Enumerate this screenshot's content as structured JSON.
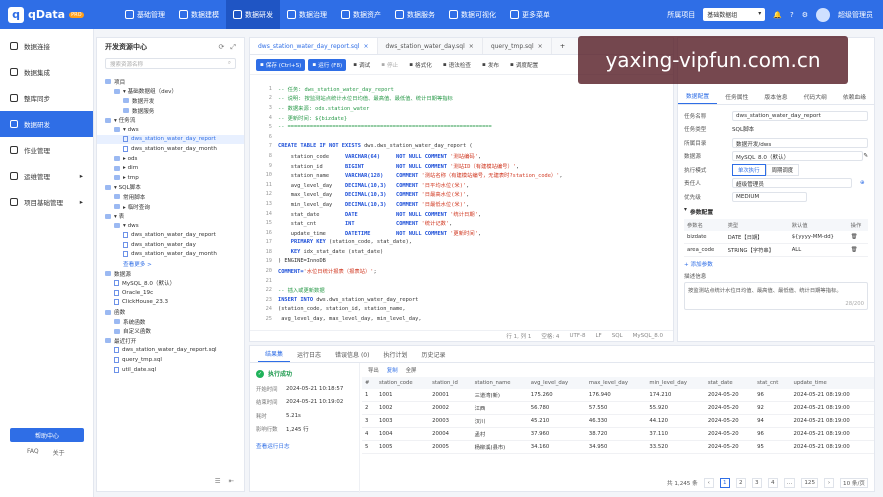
{
  "app": {
    "name": "qData",
    "badge": "PRO"
  },
  "topnav": [
    {
      "label": "基础管理",
      "icon": "grid-icon"
    },
    {
      "label": "数据建模",
      "icon": "cube-icon"
    },
    {
      "label": "数据研发",
      "icon": "code-icon",
      "active": true
    },
    {
      "label": "数据治理",
      "icon": "shield-icon"
    },
    {
      "label": "数据资产",
      "icon": "database-icon"
    },
    {
      "label": "数据服务",
      "icon": "api-icon"
    },
    {
      "label": "数据可视化",
      "icon": "chart-icon"
    },
    {
      "label": "更多菜单",
      "icon": "menu-icon"
    }
  ],
  "topright": {
    "project_label": "所属项目",
    "project_value": "基础数据组",
    "user": "超级管理员"
  },
  "sidebar": {
    "items": [
      {
        "label": "数据连接"
      },
      {
        "label": "数据集成"
      },
      {
        "label": "整库同步"
      },
      {
        "label": "数据研发",
        "active": true
      },
      {
        "label": "作业管理"
      },
      {
        "label": "运维管理",
        "arrow": "▸"
      },
      {
        "label": "项目基础管理",
        "arrow": "▸"
      }
    ],
    "help": "帮助中心",
    "faq": "FAQ",
    "about": "关于"
  },
  "tree_panel": {
    "title": "开发资源中心",
    "search_placeholder": "搜索资源名称",
    "rows": [
      {
        "indent": 0,
        "kind": "folder",
        "text": "项目"
      },
      {
        "indent": 1,
        "kind": "folder",
        "text": "▾ 基础数据组（dev）"
      },
      {
        "indent": 2,
        "kind": "folder",
        "text": "数据开发"
      },
      {
        "indent": 2,
        "kind": "folder",
        "text": "数据服务"
      },
      {
        "indent": 0,
        "kind": "folder",
        "text": "▾ 任务流"
      },
      {
        "indent": 1,
        "kind": "folder",
        "text": "▾ dws"
      },
      {
        "indent": 2,
        "kind": "file",
        "text": "dws_station_water_day_report",
        "selected": true
      },
      {
        "indent": 2,
        "kind": "file",
        "text": "dws_station_water_day_month"
      },
      {
        "indent": 1,
        "kind": "folder",
        "text": "▸ ods"
      },
      {
        "indent": 1,
        "kind": "folder",
        "text": "▸ dim"
      },
      {
        "indent": 1,
        "kind": "folder",
        "text": "▸ tmp"
      },
      {
        "indent": 0,
        "kind": "folder",
        "text": "▾ SQL脚本"
      },
      {
        "indent": 1,
        "kind": "folder",
        "text": "常用脚本"
      },
      {
        "indent": 1,
        "kind": "folder",
        "text": "▸ 临时查询"
      },
      {
        "indent": 0,
        "kind": "folder",
        "text": "▾ 表"
      },
      {
        "indent": 1,
        "kind": "folder",
        "text": "▾ dws"
      },
      {
        "indent": 2,
        "kind": "file",
        "text": "dws_station_water_day_report"
      },
      {
        "indent": 2,
        "kind": "file",
        "text": "dws_station_water_day"
      },
      {
        "indent": 2,
        "kind": "file",
        "text": "dws_station_water_day_month"
      },
      {
        "indent": 2,
        "kind": "more",
        "text": "查看更多 >"
      },
      {
        "indent": 0,
        "kind": "folder",
        "text": "数据源"
      },
      {
        "indent": 1,
        "kind": "file",
        "text": "MySQL_8.0（默认）"
      },
      {
        "indent": 1,
        "kind": "file",
        "text": "Oracle_19c"
      },
      {
        "indent": 1,
        "kind": "file",
        "text": "ClickHouse_23.3"
      },
      {
        "indent": 0,
        "kind": "folder",
        "text": "函数"
      },
      {
        "indent": 1,
        "kind": "folder",
        "text": "系统函数"
      },
      {
        "indent": 1,
        "kind": "folder",
        "text": "自定义函数"
      },
      {
        "indent": 0,
        "kind": "folder",
        "text": "最近打开"
      },
      {
        "indent": 1,
        "kind": "file",
        "text": "dws_station_water_day_report.sql"
      },
      {
        "indent": 1,
        "kind": "file",
        "text": "query_tmp.sql"
      },
      {
        "indent": 1,
        "kind": "file",
        "text": "util_date.sql"
      }
    ]
  },
  "editor": {
    "tabs": [
      {
        "label": "dws_station_water_day_report.sql",
        "active": true
      },
      {
        "label": "dws_station_water_day.sql"
      },
      {
        "label": "query_tmp.sql"
      }
    ],
    "toolbar": [
      {
        "label": "保存 (Ctrl+S)",
        "style": "primary",
        "icon": "save-icon"
      },
      {
        "label": "运行 (F8)",
        "style": "primary",
        "icon": "play-icon"
      },
      {
        "label": "调试",
        "style": "",
        "icon": "bug-icon"
      },
      {
        "label": "停止",
        "style": "dis",
        "icon": "stop-icon"
      },
      {
        "label": "格式化",
        "style": "",
        "icon": "format-icon"
      },
      {
        "label": "语法检查",
        "style": "",
        "icon": "check-icon"
      },
      {
        "label": "发布",
        "style": "",
        "icon": "publish-icon"
      },
      {
        "label": "调度配置",
        "style": "",
        "icon": "schedule-icon"
      }
    ],
    "lines": [
      {
        "no": "1",
        "parts": [
          [
            "cmt",
            "-- 任务: dws_station_water_day_report"
          ]
        ]
      },
      {
        "no": "2",
        "parts": [
          [
            "cmt",
            "-- 说明: 按监测站点统计水位日均值、最高值、最低值、统计日期等指标"
          ]
        ]
      },
      {
        "no": "3",
        "parts": [
          [
            "cmt",
            "-- 数据来源: ods.station_water"
          ]
        ]
      },
      {
        "no": "4",
        "parts": [
          [
            "cmt",
            "-- 更新时间: ${bizdate}"
          ]
        ]
      },
      {
        "no": "5",
        "parts": [
          [
            "cmt",
            "-- ================================================================"
          ]
        ]
      },
      {
        "no": "6",
        "parts": [
          [
            "",
            ""
          ]
        ]
      },
      {
        "no": "7",
        "parts": [
          [
            "kw",
            "CREATE TABLE IF NOT EXISTS "
          ],
          [
            "",
            "dws.dws_station_water_day_report ("
          ]
        ]
      },
      {
        "no": "8",
        "parts": [
          [
            "",
            "    station_code     "
          ],
          [
            "kw",
            "VARCHAR(64)     NOT NULL COMMENT "
          ],
          [
            "str",
            "'测站编码'"
          ],
          [
            "",
            ","
          ]
        ]
      },
      {
        "no": "9",
        "parts": [
          [
            "",
            "    station_id       "
          ],
          [
            "kw",
            "BIGINT          NOT NULL COMMENT "
          ],
          [
            "str",
            "'测站ID（有建模站编号）'"
          ],
          [
            "",
            ","
          ]
        ]
      },
      {
        "no": "10",
        "parts": [
          [
            "",
            "    station_name     "
          ],
          [
            "kw",
            "VARCHAR(128)    COMMENT "
          ],
          [
            "str",
            "'测站名称（有建模站编号，无建表时?station_code）'"
          ],
          [
            "",
            ","
          ]
        ]
      },
      {
        "no": "11",
        "parts": [
          [
            "",
            "    avg_level_day    "
          ],
          [
            "kw",
            "DECIMAL(10,3)   COMMENT "
          ],
          [
            "str",
            "'日平均水位(米)'"
          ],
          [
            "",
            ","
          ]
        ]
      },
      {
        "no": "12",
        "parts": [
          [
            "",
            "    max_level_day    "
          ],
          [
            "kw",
            "DECIMAL(10,3)   COMMENT "
          ],
          [
            "str",
            "'日最高水位(米)'"
          ],
          [
            "",
            ","
          ]
        ]
      },
      {
        "no": "13",
        "parts": [
          [
            "",
            "    min_level_day    "
          ],
          [
            "kw",
            "DECIMAL(10,3)   COMMENT "
          ],
          [
            "str",
            "'日最低水位(米)'"
          ],
          [
            "",
            ","
          ]
        ]
      },
      {
        "no": "14",
        "parts": [
          [
            "",
            "    stat_date        "
          ],
          [
            "kw",
            "DATE            NOT NULL COMMENT "
          ],
          [
            "str",
            "'统计日期'"
          ],
          [
            "",
            ","
          ]
        ]
      },
      {
        "no": "15",
        "parts": [
          [
            "",
            "    stat_cnt         "
          ],
          [
            "kw",
            "INT             COMMENT "
          ],
          [
            "str",
            "'统计记数'"
          ],
          [
            "",
            ","
          ]
        ]
      },
      {
        "no": "16",
        "parts": [
          [
            "",
            "    update_time      "
          ],
          [
            "kw",
            "DATETIME        NOT NULL COMMENT "
          ],
          [
            "str",
            "'更新时间'"
          ],
          [
            "",
            ","
          ]
        ]
      },
      {
        "no": "17",
        "parts": [
          [
            "kw",
            "    PRIMARY KEY "
          ],
          [
            "",
            "(station_code, stat_date),"
          ]
        ]
      },
      {
        "no": "18",
        "parts": [
          [
            "kw",
            "    KEY "
          ],
          [
            "",
            "idx_stat_date (stat_date)"
          ]
        ]
      },
      {
        "no": "19",
        "parts": [
          [
            "",
            ") ENGINE=InnoDB"
          ]
        ]
      },
      {
        "no": "20",
        "parts": [
          [
            "kw",
            "COMMENT="
          ],
          [
            "str",
            "'水位日统计报表（报表站）'"
          ],
          [
            "",
            ";"
          ]
        ]
      },
      {
        "no": "21",
        "parts": [
          [
            "",
            ""
          ]
        ]
      },
      {
        "no": "22",
        "parts": [
          [
            "cmt",
            "-- 插入或更新数据"
          ]
        ]
      },
      {
        "no": "23",
        "parts": [
          [
            "kw",
            "INSERT INTO "
          ],
          [
            "",
            "dws.dws_station_water_day_report"
          ]
        ]
      },
      {
        "no": "24",
        "parts": [
          [
            "",
            "(station_code, station_id, station_name,"
          ]
        ]
      },
      {
        "no": "25",
        "parts": [
          [
            "",
            " avg_level_day, max_level_day, min_level_day,"
          ]
        ]
      }
    ],
    "status": [
      "行 1, 列 1",
      "空格: 4",
      "UTF-8",
      "LF",
      "SQL",
      "MySQL_8.0"
    ]
  },
  "props": {
    "tabs": [
      "数据配置",
      "任务属性",
      "版本信息",
      "代码大纲",
      "依赖血缘"
    ],
    "fields": [
      {
        "label": "任务名称",
        "value": "dws_station_water_day_report",
        "box": true
      },
      {
        "label": "任务类型",
        "value": "SQL脚本",
        "box": false
      },
      {
        "label": "所属目录",
        "value": "数据开发/dws",
        "box": true
      },
      {
        "label": "数据源",
        "value": "MySQL_8.0（默认）",
        "box": true
      }
    ],
    "exec_mode_label": "执行模式",
    "exec_modes": [
      "单次执行",
      "周期调度"
    ],
    "owner_label": "责任人",
    "owner_value": "超级管理员",
    "priority_label": "优先级",
    "priority_value": "MEDIUM",
    "param_title": "参数配置",
    "param_cols": [
      "参数名",
      "类型",
      "默认值",
      "操作"
    ],
    "params": [
      {
        "name": "bizdate",
        "type": "DATE【日期】",
        "default": "${yyyy-MM-dd}"
      },
      {
        "name": "area_code",
        "type": "STRING【字符串】",
        "default": "ALL"
      }
    ],
    "add_param": "+ 添加参数",
    "desc_label": "描述信息",
    "desc_text": "按监测站点统计水位日均值、最高值、最低值、统计日期等指标。",
    "desc_count": "28/200"
  },
  "results": {
    "tabs": [
      "结果集",
      "运行日志",
      "错误信息 (0)",
      "执行计划",
      "历史记录"
    ],
    "status": "执行成功",
    "kv": [
      {
        "k": "开始时间",
        "v": "2024-05-21 10:18:57"
      },
      {
        "k": "结束时间",
        "v": "2024-05-21 10:19:02"
      },
      {
        "k": "耗时",
        "v": "5.21s"
      },
      {
        "k": "影响行数",
        "v": "1,245 行"
      }
    ],
    "log_link": "查看运行日志",
    "tools": [
      "导出",
      "复制",
      "全屏"
    ],
    "columns": [
      "#",
      "station_code",
      "station_id",
      "station_name",
      "avg_level_day",
      "max_level_day",
      "min_level_day",
      "stat_date",
      "stat_cnt",
      "update_time"
    ],
    "rows": [
      [
        "1",
        "1001",
        "20001",
        "三道湾(新)",
        "175.260",
        "176.940",
        "174.210",
        "2024-05-20",
        "96",
        "2024-05-21 08:19:00"
      ],
      [
        "2",
        "1002",
        "20002",
        "江西",
        "56.780",
        "57.550",
        "55.920",
        "2024-05-20",
        "92",
        "2024-05-21 08:19:00"
      ],
      [
        "3",
        "1003",
        "20003",
        "汉川",
        "45.210",
        "46.330",
        "44.120",
        "2024-05-20",
        "94",
        "2024-05-21 08:19:00"
      ],
      [
        "4",
        "1004",
        "20004",
        "孟村",
        "37.960",
        "38.720",
        "37.110",
        "2024-05-20",
        "96",
        "2024-05-21 08:19:00"
      ],
      [
        "5",
        "1005",
        "20005",
        "杨柳溪(县市)",
        "34.160",
        "34.950",
        "33.520",
        "2024-05-20",
        "95",
        "2024-05-21 08:19:00"
      ]
    ],
    "pager_total": "共 1,245 条",
    "pages": [
      "1",
      "2",
      "3",
      "4",
      "…",
      "125"
    ],
    "page_size": "10 条/页"
  },
  "watermark": "yaxing-vipfun.com.cn"
}
